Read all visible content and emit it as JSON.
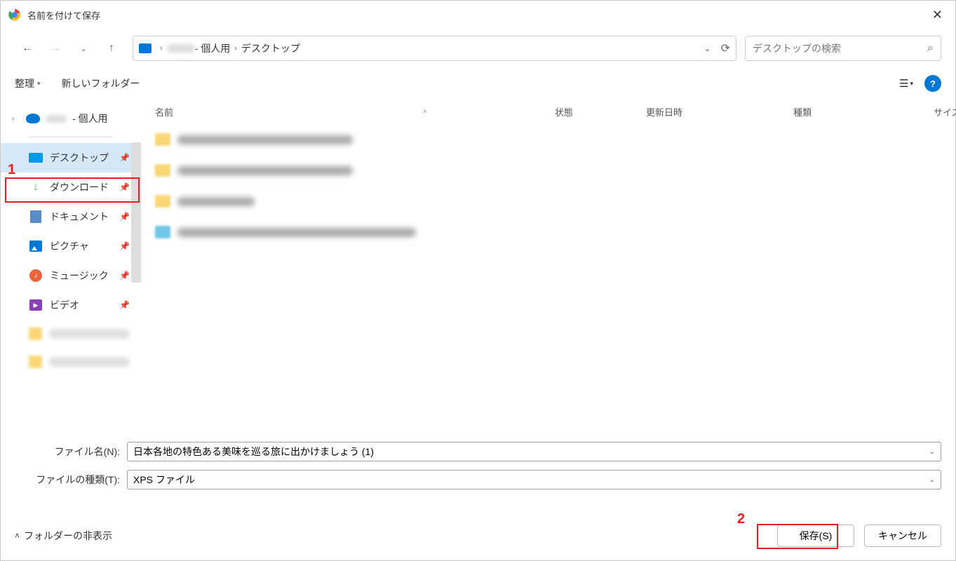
{
  "title": "名前を付けて保存",
  "breadcrumb": {
    "part1": "- 個人用",
    "part2": "デスクトップ"
  },
  "search_placeholder": "デスクトップの検索",
  "toolbar": {
    "organize": "整理",
    "new_folder": "新しいフォルダー"
  },
  "tree": {
    "personal": "- 個人用"
  },
  "quick": {
    "desktop": "デスクトップ",
    "downloads": "ダウンロード",
    "documents": "ドキュメント",
    "pictures": "ピクチャ",
    "music": "ミュージック",
    "videos": "ビデオ"
  },
  "columns": {
    "name": "名前",
    "state": "状態",
    "date": "更新日時",
    "type": "種類",
    "size": "サイズ"
  },
  "form": {
    "filename_label": "ファイル名(N):",
    "filename_value": "日本各地の特色ある美味を巡る旅に出かけましょう (1)",
    "filetype_label": "ファイルの種類(T):",
    "filetype_value": "XPS ファイル"
  },
  "footer": {
    "folder_toggle": "フォルダーの非表示",
    "save": "保存(S)",
    "cancel": "キャンセル"
  },
  "annotations": {
    "n1": "1",
    "n2": "2"
  }
}
